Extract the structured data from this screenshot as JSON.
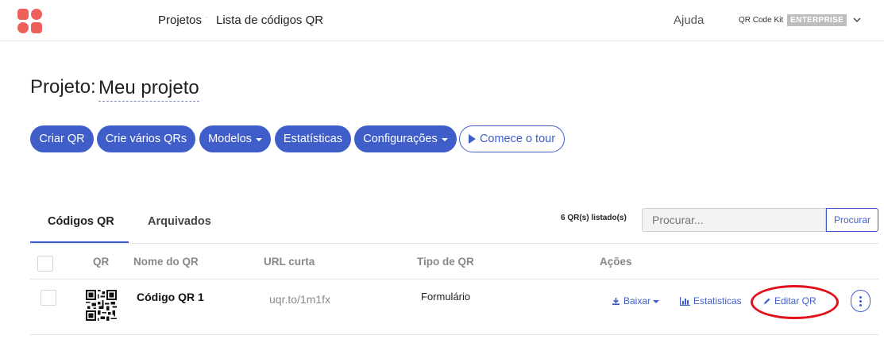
{
  "header": {
    "breadcrumb": {
      "projects": "Projetos",
      "separator": "·",
      "current": "Lista de códigos QR"
    },
    "help": "Ajuda",
    "brand": {
      "name": "QR Code Kit",
      "badge": "ENTERPRISE"
    }
  },
  "project": {
    "label": "Projeto:",
    "name": "Meu projeto"
  },
  "toolbar": {
    "create_qr": "Criar QR",
    "create_many": "Crie vários QRs",
    "templates": "Modelos",
    "statistics": "Estatísticas",
    "settings": "Configurações",
    "tour": "Comece o tour"
  },
  "tabs": {
    "qr_codes": "Códigos QR",
    "archived": "Arquivados"
  },
  "list": {
    "count_text": "6 QR(s) listado(s)",
    "search_placeholder": "Procurar...",
    "search_button": "Procurar"
  },
  "table": {
    "headers": {
      "qr": "QR",
      "name": "Nome do QR",
      "short_url": "URL curta",
      "type": "Tipo de QR",
      "actions": "Ações"
    },
    "rows": [
      {
        "name": "Código QR 1",
        "short_url": "uqr.to/1m1fx",
        "type": "Formulário",
        "actions": {
          "download": "Baixar",
          "stats": "Estatisticas",
          "edit": "Editar QR"
        }
      }
    ]
  },
  "colors": {
    "primary": "#3f5ec9",
    "logo": "#f0605a",
    "annotation": "#e3101b"
  }
}
